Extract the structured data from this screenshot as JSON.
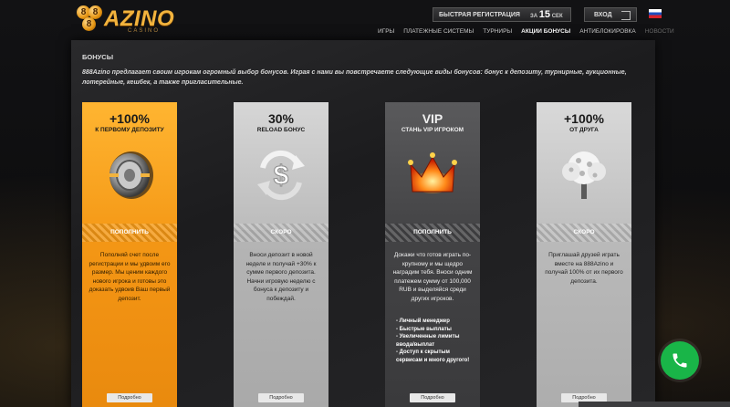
{
  "header": {
    "logo_text": "AZINO",
    "logo_digits": "888",
    "logo_sub": "CASINO",
    "register_label": "БЫСТРАЯ РЕГИСТРАЦИЯ",
    "register_time_prefix": "ЗА",
    "register_time_value": "15",
    "register_time_unit": "СЕК",
    "login_label": "ВХОД",
    "flag": "russia-flag"
  },
  "nav": {
    "items": [
      "ИГРЫ",
      "ПЛАТЕЖНЫЕ СИСТЕМЫ",
      "ТУРНИРЫ",
      "АКЦИИ БОНУСЫ",
      "АНТИБЛОКИРОВКА",
      "НОВОСТИ"
    ],
    "active_index": 3
  },
  "section": {
    "title": "БОНУСЫ",
    "intro": "888Azino предлагает своим игрокам огромный выбор бонусов. Играя с нами вы повстречаете следующие виды бонусов: бонус к депозиту, турнирные, аукционные, лотерейные, кешбек, а также пригласительные."
  },
  "cards": [
    {
      "big": "+100%",
      "small": "К ПЕРВОМУ ДЕПОЗИТУ",
      "action": "ПОПОЛНИТЬ",
      "body": "Пополняй счет после регистрации и мы удвоим его размер. Мы ценим каждого нового игрока и готовы это доказать удвоив Ваш первый депозит.",
      "more": "Подробно",
      "icon": "vault-icon",
      "color": "#f59a18"
    },
    {
      "big": "30%",
      "small": "RELOAD БОНУС",
      "action": "СКОРО",
      "body": "Вноси депозит в новой неделе и получай +30% к сумме первого депозита. Начни игровую неделю с бонуса к депозиту и побеждай.",
      "more": "Подробно",
      "icon": "dollar-arrows-icon",
      "color": "#bcbcbc"
    },
    {
      "big": "VIP",
      "small": "СТАНЬ VIP ИГРОКОМ",
      "action": "ПОПОЛНИТЬ",
      "body": "Докажи что готов играть по-крупному и мы щедро наградим тебя. Вноси одним платежем сумму от 100,000 RUB и выделяйся среди других игроков.",
      "list": [
        "- Личный менеджер",
        "- Быстрые выплаты",
        "- Увеличенные лимиты ввода/выплат",
        "- Доступ к скрытым сервисам и много другого!"
      ],
      "more": "Подробно",
      "icon": "crown-icon",
      "color": "#444446"
    },
    {
      "big": "+100%",
      "small": "ОТ ДРУГА",
      "action": "СКОРО",
      "body": "Приглашай друзей играть вместе на 888Azino и получай 100% от их первого депозита.",
      "more": "Подробно",
      "icon": "money-tree-icon",
      "color": "#bfbfbf"
    }
  ]
}
